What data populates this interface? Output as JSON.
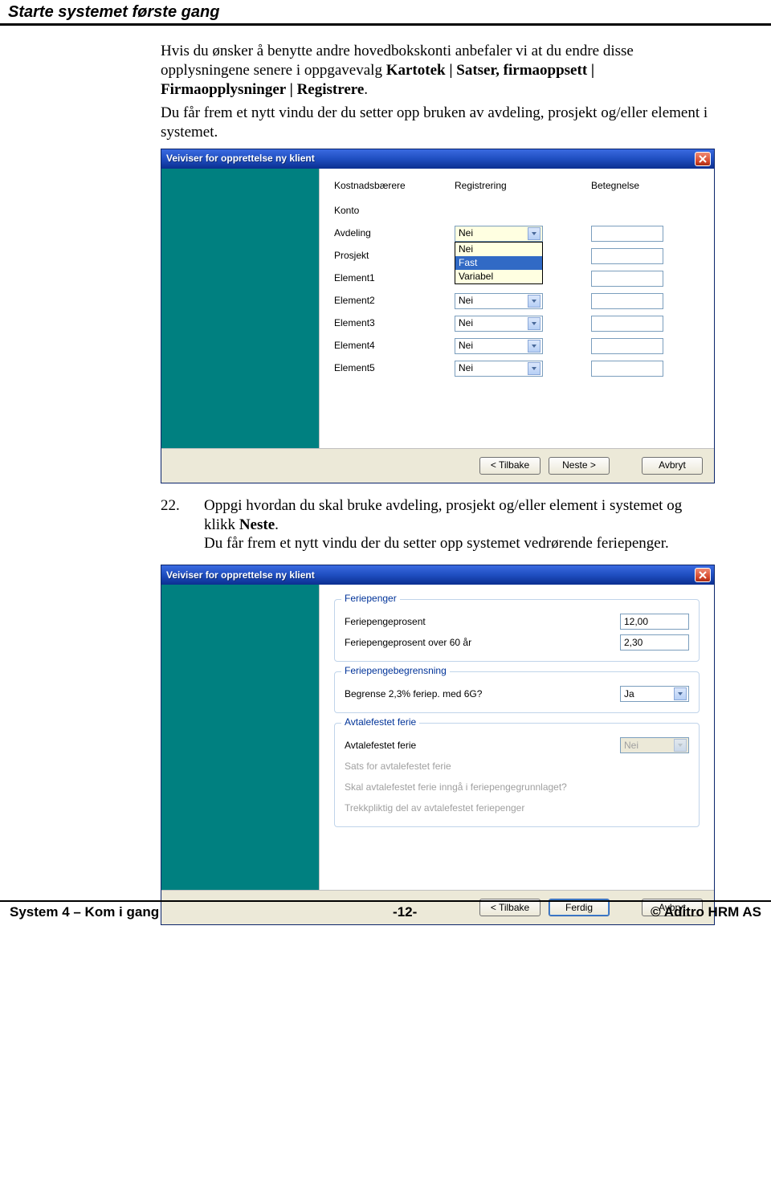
{
  "page": {
    "header": "Starte systemet første gang",
    "footer_left": "System 4 – Kom i gang",
    "footer_center": "-12-",
    "footer_right": "© Aditro HRM AS"
  },
  "para1": {
    "t1": "Hvis du ønsker å benytte andre hovedbokskonti anbefaler vi at du endre disse opplysningene senere i oppgavevalg ",
    "b1": "Kartotek | Satser, firmaoppsett | Firmaopplysninger | Registrere",
    "t2": ".",
    "t3": "Du får frem et nytt vindu der du setter opp bruken av avdeling, prosjekt og/eller element i systemet."
  },
  "dialog1": {
    "title": "Veiviser for opprettelse ny klient",
    "columns": {
      "c1": "Kostnadsbærere",
      "c2": "Registrering",
      "c3": "Betegnelse"
    },
    "rows": [
      {
        "label": "Konto",
        "value": "",
        "combo": false,
        "betegnelse": false
      },
      {
        "label": "Avdeling",
        "value": "Nei",
        "combo": true,
        "open": true,
        "betegnelse": true
      },
      {
        "label": "Prosjekt",
        "value": "",
        "combo": false,
        "betegnelse": true
      },
      {
        "label": "Element1",
        "value": "",
        "combo": false,
        "betegnelse": true
      },
      {
        "label": "Element2",
        "value": "Nei",
        "combo": true,
        "betegnelse": true
      },
      {
        "label": "Element3",
        "value": "Nei",
        "combo": true,
        "betegnelse": true
      },
      {
        "label": "Element4",
        "value": "Nei",
        "combo": true,
        "betegnelse": true
      },
      {
        "label": "Element5",
        "value": "Nei",
        "combo": true,
        "betegnelse": true
      }
    ],
    "options": [
      "Nei",
      "Fast",
      "Variabel"
    ],
    "selected_option": "Fast",
    "buttons": {
      "back": "< Tilbake",
      "next": "Neste >",
      "cancel": "Avbryt"
    }
  },
  "step22": {
    "num": "22.",
    "t1": "Oppgi hvordan du skal bruke avdeling, prosjekt og/eller element i systemet og klikk ",
    "b1": "Neste",
    "t2": ".",
    "t3": "Du får frem et nytt vindu der du setter opp systemet vedrørende feriepenger."
  },
  "dialog2": {
    "title": "Veiviser for opprettelse ny klient",
    "group1": {
      "legend": "Feriepenger",
      "r1_label": "Feriepengeprosent",
      "r1_value": "12,00",
      "r2_label": "Feriepengeprosent over 60 år",
      "r2_value": "2,30"
    },
    "group2": {
      "legend": "Feriepengebegrensning",
      "r1_label": "Begrense 2,3% feriep. med 6G?",
      "r1_value": "Ja"
    },
    "group3": {
      "legend": "Avtalefestet ferie",
      "r1_label": "Avtalefestet ferie",
      "r1_value": "Nei",
      "r2_label": "Sats for avtalefestet ferie",
      "r3_label": "Skal avtalefestet ferie inngå i feriepengegrunnlaget?",
      "r4_label": "Trekkpliktig del av avtalefestet feriepenger"
    },
    "buttons": {
      "back": "< Tilbake",
      "finish": "Ferdig",
      "cancel": "Avbryt"
    }
  }
}
